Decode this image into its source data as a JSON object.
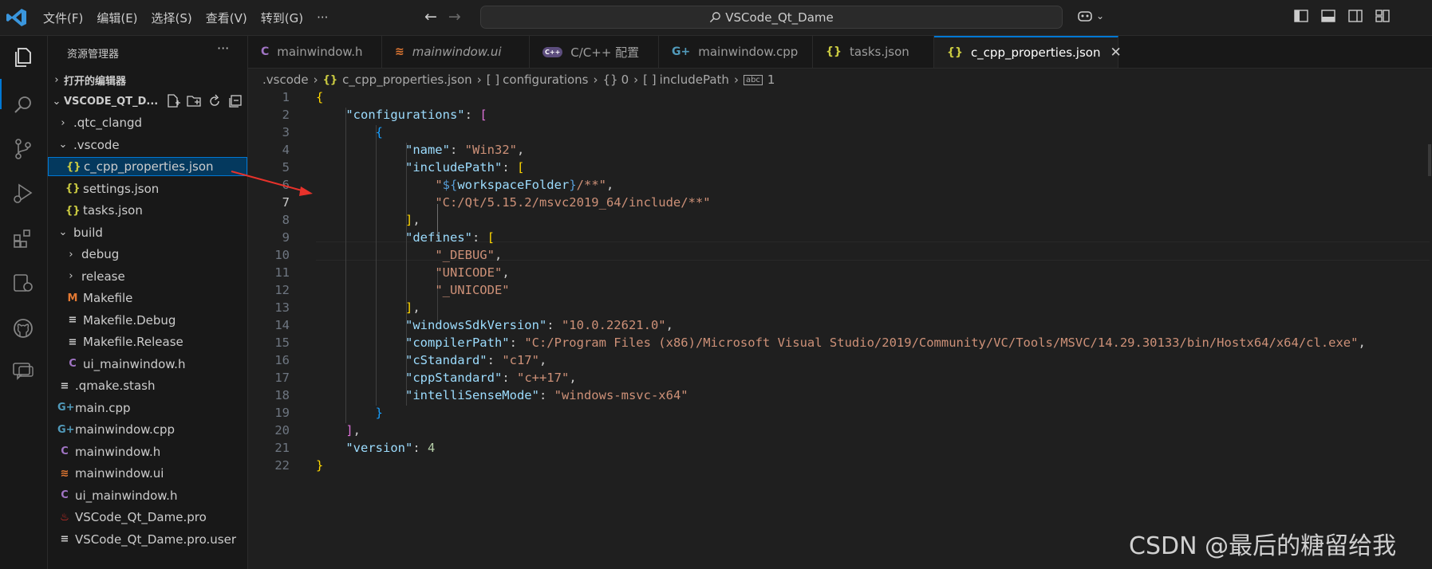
{
  "titlebar": {
    "menu": [
      "文件(F)",
      "编辑(E)",
      "选择(S)",
      "查看(V)",
      "转到(G)",
      "···"
    ],
    "search_text": "VSCode_Qt_Dame"
  },
  "sidebar": {
    "title": "资源管理器",
    "more": "···",
    "open_editors": "打开的编辑器",
    "workspace": "VSCODE_QT_D...",
    "items": [
      {
        "label": ".qtc_clangd",
        "chev": "›",
        "icon": ""
      },
      {
        "label": ".vscode",
        "chev": "⌄",
        "icon": ""
      },
      {
        "label": "c_cpp_properties.json",
        "chev": "",
        "icon": "{}"
      },
      {
        "label": "settings.json",
        "chev": "",
        "icon": "{}"
      },
      {
        "label": "tasks.json",
        "chev": "",
        "icon": "{}"
      },
      {
        "label": "build",
        "chev": "⌄",
        "icon": ""
      },
      {
        "label": "debug",
        "chev": "›",
        "icon": ""
      },
      {
        "label": "release",
        "chev": "›",
        "icon": ""
      },
      {
        "label": "Makefile",
        "chev": "",
        "icon": "M"
      },
      {
        "label": "Makefile.Debug",
        "chev": "",
        "icon": "≡"
      },
      {
        "label": "Makefile.Release",
        "chev": "",
        "icon": "≡"
      },
      {
        "label": "ui_mainwindow.h",
        "chev": "",
        "icon": "C"
      },
      {
        "label": ".qmake.stash",
        "chev": "",
        "icon": "≡"
      },
      {
        "label": "main.cpp",
        "chev": "",
        "icon": "G+"
      },
      {
        "label": "mainwindow.cpp",
        "chev": "",
        "icon": "G+"
      },
      {
        "label": "mainwindow.h",
        "chev": "",
        "icon": "C"
      },
      {
        "label": "mainwindow.ui",
        "chev": "",
        "icon": "≋"
      },
      {
        "label": "ui_mainwindow.h",
        "chev": "",
        "icon": "C"
      },
      {
        "label": "VSCode_Qt_Dame.pro",
        "chev": "",
        "icon": "♨"
      },
      {
        "label": "VSCode_Qt_Dame.pro.user",
        "chev": "",
        "icon": "≡"
      }
    ]
  },
  "tabs": [
    {
      "label": "mainwindow.h",
      "icon": "C"
    },
    {
      "label": "mainwindow.ui",
      "icon": "≋"
    },
    {
      "label": "C/C++ 配置",
      "icon": "C++"
    },
    {
      "label": "mainwindow.cpp",
      "icon": "G+"
    },
    {
      "label": "tasks.json",
      "icon": "{}"
    },
    {
      "label": "c_cpp_properties.json",
      "icon": "{}"
    }
  ],
  "breadcrumb": [
    ".vscode",
    "c_cpp_properties.json",
    "configurations",
    "0",
    "includePath",
    "1"
  ],
  "code": {
    "line_numbers": [
      "1",
      "2",
      "3",
      "4",
      "5",
      "6",
      "7",
      "8",
      "9",
      "10",
      "11",
      "12",
      "13",
      "14",
      "15",
      "16",
      "17",
      "18",
      "19",
      "20",
      "21",
      "22"
    ],
    "k_configurations": "\"configurations\"",
    "k_name": "\"name\"",
    "v_name": "\"Win32\"",
    "k_includePath": "\"includePath\"",
    "inc_1_a": "\"",
    "inc_1_b": "${",
    "inc_1_c": "workspaceFolder",
    "inc_1_d": "}",
    "inc_1_e": "/**\"",
    "inc_2": "\"C:/Qt/5.15.2/msvc2019_64/include/**\"",
    "k_defines": "\"defines\"",
    "def_1": "\"_DEBUG\"",
    "def_2": "\"UNICODE\"",
    "def_3": "\"_UNICODE\"",
    "k_sdk": "\"windowsSdkVersion\"",
    "v_sdk": "\"10.0.22621.0\"",
    "k_compiler": "\"compilerPath\"",
    "v_compiler": "\"C:/Program Files (x86)/Microsoft Visual Studio/2019/Community/VC/Tools/MSVC/14.29.30133/bin/Hostx64/x64/cl.exe\"",
    "k_cstd": "\"cStandard\"",
    "v_cstd": "\"c17\"",
    "k_cppstd": "\"cppStandard\"",
    "v_cppstd": "\"c++17\"",
    "k_intelli": "\"intelliSenseMode\"",
    "v_intelli": "\"windows-msvc-x64\"",
    "k_version": "\"version\"",
    "v_version": "4"
  },
  "watermark": "CSDN @最后的糖留给我",
  "colors": {
    "accent": "#0078d4",
    "arrow": "#e8322b"
  }
}
